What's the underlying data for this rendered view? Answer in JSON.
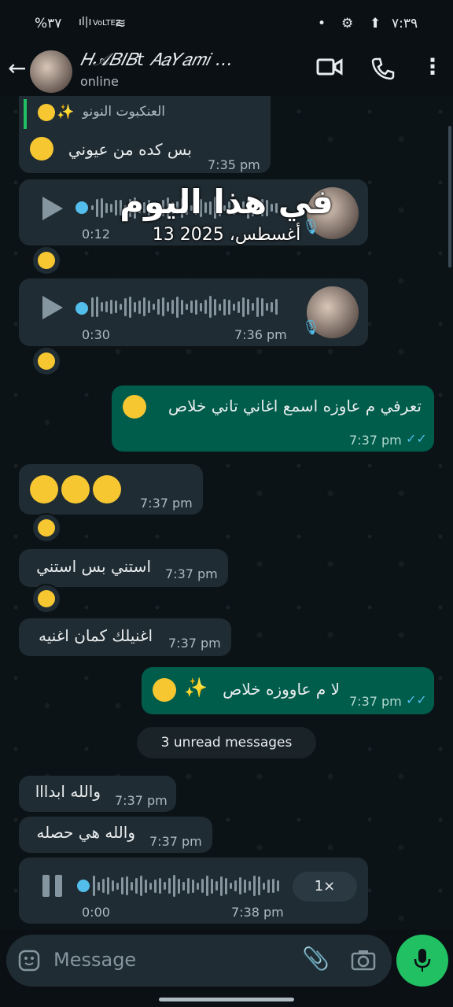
{
  "status_bar": {
    "time": "٧:٣٩",
    "battery": "%٣٧",
    "network": "VoLTE2"
  },
  "header": {
    "contact_name": "𝐻𝒜𝐵𝐼𝐵t 𝐴𝑎𝑌𝑎𝑚𝑖 …",
    "status": "online"
  },
  "overlay": {
    "title": "في هذا اليوم",
    "date": "13 أغسطس، 2025"
  },
  "messages": [
    {
      "quote": "العنكبوت النونو",
      "text": "بس كده من عيوني",
      "time": "7:35 pm"
    },
    {
      "duration": "0:12",
      "time": ""
    },
    {
      "duration": "0:30",
      "time": "7:36 pm"
    },
    {
      "text": "تعرفي م عاوزه اسمع اغاني تاني خلاص",
      "time": "7:37 pm"
    },
    {
      "text": "",
      "time": "7:37 pm"
    },
    {
      "text": "استني بس استني",
      "time": "7:37 pm"
    },
    {
      "text": "اغنيلك كمان اغنيه",
      "time": "7:37 pm"
    },
    {
      "text": "لا م عاووزه خلاص",
      "time": "7:37 pm"
    },
    {
      "text": "والله ابدااا",
      "time": "7:37 pm"
    },
    {
      "text": "والله هي حصله",
      "time": "7:37 pm"
    },
    {
      "duration": "0:00",
      "time": "7:38 pm",
      "speed": "1×"
    }
  ],
  "unread": "3 unread messages",
  "composer": {
    "placeholder": "Message"
  },
  "colors": {
    "accent": "#21c063",
    "outgoing": "#005c4b",
    "incoming": "#202c33",
    "tick": "#53bdeb"
  }
}
